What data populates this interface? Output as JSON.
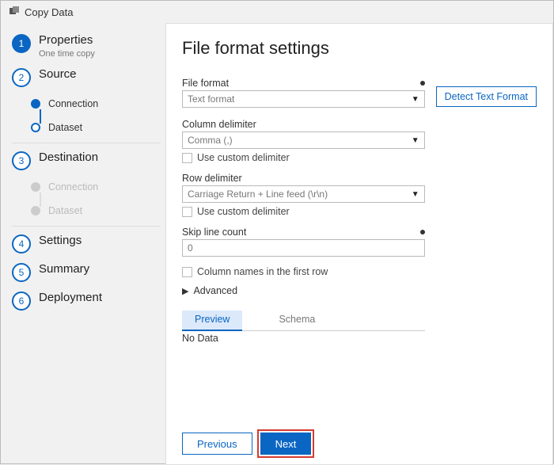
{
  "app": {
    "title": "Copy Data"
  },
  "sidebar": {
    "steps": [
      {
        "num": "1",
        "label": "Properties",
        "sub": "One time copy"
      },
      {
        "num": "2",
        "label": "Source",
        "children": [
          {
            "label": "Connection"
          },
          {
            "label": "Dataset"
          }
        ]
      },
      {
        "num": "3",
        "label": "Destination",
        "children": [
          {
            "label": "Connection"
          },
          {
            "label": "Dataset"
          }
        ]
      },
      {
        "num": "4",
        "label": "Settings"
      },
      {
        "num": "5",
        "label": "Summary"
      },
      {
        "num": "6",
        "label": "Deployment"
      }
    ]
  },
  "main": {
    "title": "File format settings",
    "detect_button": "Detect Text Format",
    "file_format": {
      "label": "File format",
      "value": "Text format"
    },
    "column_delimiter": {
      "label": "Column delimiter",
      "value": "Comma (,)",
      "custom_label": "Use custom delimiter"
    },
    "row_delimiter": {
      "label": "Row delimiter",
      "value": "Carriage Return + Line feed (\\r\\n)",
      "custom_label": "Use custom delimiter"
    },
    "skip_line": {
      "label": "Skip line count",
      "value": "0"
    },
    "first_row_names": {
      "label": "Column names in the first row"
    },
    "advanced": {
      "label": "Advanced"
    },
    "tabs": {
      "preview": "Preview",
      "schema": "Schema"
    },
    "nodata": "No Data",
    "buttons": {
      "previous": "Previous",
      "next": "Next"
    }
  }
}
